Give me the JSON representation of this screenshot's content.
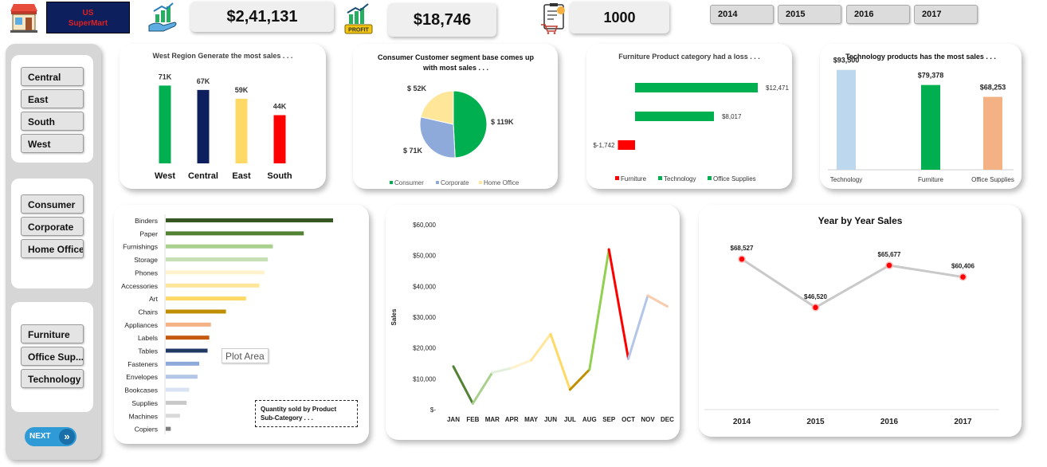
{
  "brand": {
    "line1": "US",
    "line2": "SuperMart",
    "bg": "#0d1f5c",
    "fg": "#e02020"
  },
  "kpis": {
    "sales": "$2,41,131",
    "profit": "$18,746",
    "quantity": "1000",
    "profit_badge": "PROFIT"
  },
  "years": [
    "2014",
    "2015",
    "2016",
    "2017"
  ],
  "regions": [
    "Central",
    "East",
    "South",
    "West"
  ],
  "segments": [
    "Consumer",
    "Corporate",
    "Home Office"
  ],
  "categories": [
    "Furniture",
    "Office Sup...",
    "Technology"
  ],
  "next_label": "NEXT",
  "tooltip": "Plot Area",
  "chart_data": [
    {
      "id": "region",
      "type": "bar",
      "title": "West Region Generate the most sales . . .",
      "categories": [
        "West",
        "Central",
        "East",
        "South"
      ],
      "values": [
        71,
        67,
        59,
        44
      ],
      "labels": [
        "71K",
        "67K",
        "59K",
        "44K"
      ],
      "colors": [
        "#00b050",
        "#0d1f5c",
        "#ffd966",
        "#ff0000"
      ],
      "ylim": [
        0,
        80
      ]
    },
    {
      "id": "segment",
      "type": "pie",
      "title": "Consumer Customer segment base comes up with  most sales . . .",
      "categories": [
        "Consumer",
        "Corporate",
        "Home Office"
      ],
      "values": [
        119,
        71,
        52
      ],
      "labels": [
        "$ 119K",
        "$ 71K",
        "$ 52K"
      ],
      "colors": [
        "#00b050",
        "#8eaadb",
        "#ffe699"
      ]
    },
    {
      "id": "profit_category",
      "type": "bar",
      "title": "Furniture Product category had a loss . . .",
      "categories": [
        "Office Supplies",
        "Technology",
        "Furniture"
      ],
      "values": [
        12471,
        8017,
        -1742
      ],
      "labels": [
        "$12,471",
        "$8,017",
        "$-1,742"
      ],
      "colors": [
        "#00b050",
        "#00b050",
        "#ff0000"
      ],
      "legend": [
        "Furniture",
        "Technology",
        "Office Supplies"
      ],
      "legend_colors": [
        "#ff0000",
        "#00b050",
        "#00b050"
      ]
    },
    {
      "id": "category_sales",
      "type": "bar",
      "title": "Technology products has the most sales . . .",
      "categories": [
        "Technology",
        "Furniture",
        "Office Supplies"
      ],
      "values": [
        93500,
        79378,
        68253
      ],
      "labels": [
        "$93,500",
        "$79,378",
        "$68,253"
      ],
      "colors": [
        "#bdd7ee",
        "#00b050",
        "#f4b183"
      ],
      "ylim": [
        0,
        100000
      ]
    },
    {
      "id": "subcategory_qty",
      "type": "bar",
      "title": "Quantity sold by Product Sub-Category . . .",
      "categories": [
        "Binders",
        "Paper",
        "Furnishings",
        "Storage",
        "Phones",
        "Accessories",
        "Art",
        "Chairs",
        "Appliances",
        "Labels",
        "Tables",
        "Fasteners",
        "Envelopes",
        "Bookcases",
        "Supplies",
        "Machines",
        "Copiers"
      ],
      "values": [
        200,
        165,
        128,
        122,
        118,
        112,
        96,
        72,
        54,
        52,
        50,
        40,
        38,
        28,
        25,
        17,
        6
      ],
      "colors": [
        "#375623",
        "#548235",
        "#a9d08e",
        "#c6e0b4",
        "#fff2cc",
        "#ffe699",
        "#ffd966",
        "#bf8f00",
        "#f4b183",
        "#c55a11",
        "#1f3864",
        "#8eaadb",
        "#b4c6e7",
        "#dae3f3",
        "#c9c9c9",
        "#d9d9d9",
        "#7f7f7f"
      ]
    },
    {
      "id": "monthly",
      "type": "line",
      "title": "",
      "ylabel": "Sales",
      "categories": [
        "JAN",
        "FEB",
        "MAR",
        "APR",
        "MAY",
        "JUN",
        "JUL",
        "AUG",
        "SEP",
        "OCT",
        "NOV",
        "DEC"
      ],
      "values": [
        14000,
        2000,
        12000,
        13500,
        16000,
        24500,
        6500,
        13000,
        52000,
        16500,
        37000,
        33500
      ],
      "yticks": [
        "$-",
        "$10,000",
        "$20,000",
        "$30,000",
        "$40,000",
        "$50,000",
        "$60,000"
      ],
      "ylim": [
        0,
        60000
      ],
      "segment_colors": [
        "#548235",
        "#a9d08e",
        "#e2efda",
        "#fff2cc",
        "#ffe699",
        "#ffd966",
        "#bf8f00",
        "#92d050",
        "#ff0000",
        "#b4c6e7",
        "#f8cbad"
      ]
    },
    {
      "id": "yearly",
      "type": "line",
      "title": "Year by Year Sales",
      "categories": [
        "2014",
        "2015",
        "2016",
        "2017"
      ],
      "values": [
        68527,
        46520,
        65677,
        60406
      ],
      "labels": [
        "$68,527",
        "$46,520",
        "$65,677",
        "$60,406"
      ],
      "ylim": [
        0,
        90000
      ],
      "line_color": "#c9c9c9",
      "marker_color": "#ff0000"
    }
  ]
}
